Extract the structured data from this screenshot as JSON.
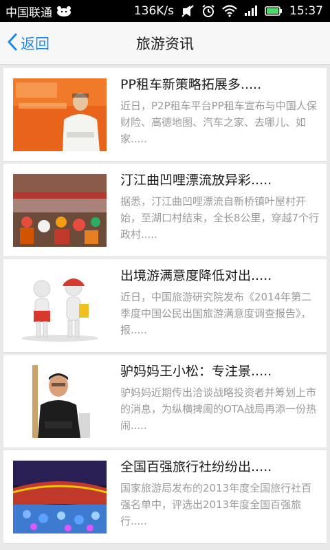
{
  "status_bar": {
    "carrier": "中国联通",
    "speed": "136K/s",
    "time": "15:37"
  },
  "header": {
    "back_label": "返回",
    "title": "旅游资讯"
  },
  "news": [
    {
      "title": "PP租车新策略拓展多.....",
      "summary": "近日，P2P租车平台PP租车宣布与中国人保财险、高德地图、汽车之家、去哪儿、如家....."
    },
    {
      "title": "汀江曲凹哩漂流放异彩.....",
      "summary": "据悉，汀江曲凹哩漂流自新桥镇叶屋村开始，至湖口村结束，全长8公里，穿越7个行政村....."
    },
    {
      "title": "出境游满意度降低对出.....",
      "summary": "近日，中国旅游研究院发布《2014年第二季度中国公民出国旅游满意度调查报告》，报....."
    },
    {
      "title": "驴妈妈王小松：专注景.....",
      "summary": "驴妈妈近期传出洽谈战略投资者并筹划上市的消息，为纵横捭阖的OTA战局再添一份热闹....."
    },
    {
      "title": "全国百强旅行社纷纷出.....",
      "summary": "国家旅游局发布的2013年度全国旅行社百强名单中，评选出2013年度全国百强旅行....."
    }
  ]
}
